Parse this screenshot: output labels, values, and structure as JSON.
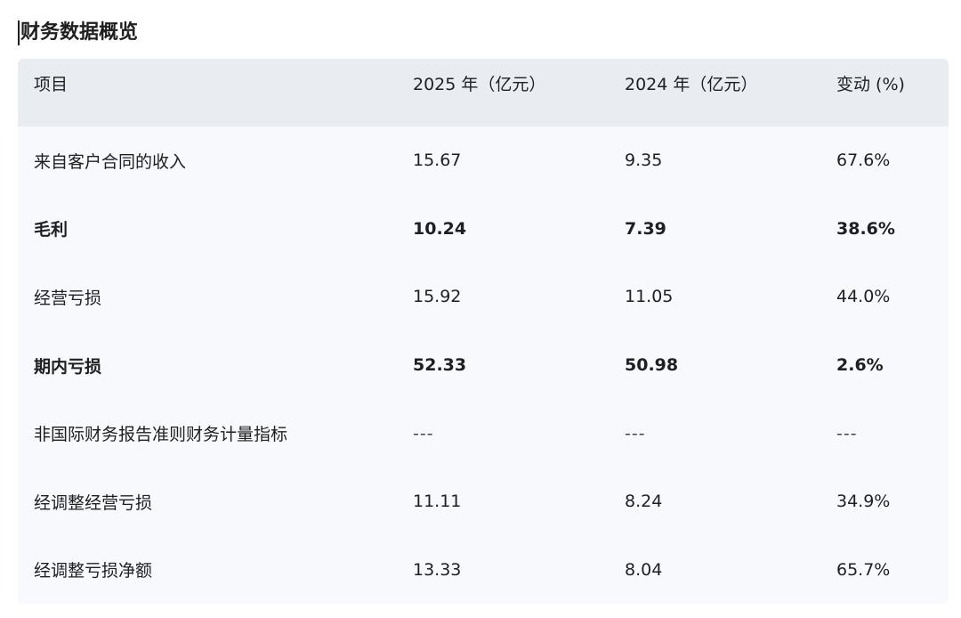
{
  "title": "财务数据概览",
  "table": {
    "headers": [
      "项目",
      "2025 年（亿元）",
      "2024 年（亿元）",
      "变动 (%)"
    ],
    "rows": [
      {
        "item": "来自客户合同的收入",
        "y2025": "15.67",
        "y2024": "9.35",
        "change": "67.6%",
        "bold": false
      },
      {
        "item": "毛利",
        "y2025": "10.24",
        "y2024": "7.39",
        "change": "38.6%",
        "bold": true
      },
      {
        "item": "经营亏损",
        "y2025": "15.92",
        "y2024": "11.05",
        "change": "44.0%",
        "bold": false
      },
      {
        "item": "期内亏损",
        "y2025": "52.33",
        "y2024": "50.98",
        "change": "2.6%",
        "bold": true
      },
      {
        "item": "非国际财务报告准则财务计量指标",
        "y2025": "---",
        "y2024": "---",
        "change": "---",
        "bold": false
      },
      {
        "item": "经调整经营亏损",
        "y2025": "11.11",
        "y2024": "8.24",
        "change": "34.9%",
        "bold": false
      },
      {
        "item": "经调整亏损净额",
        "y2025": "13.33",
        "y2024": "8.04",
        "change": "65.7%",
        "bold": false
      }
    ]
  }
}
